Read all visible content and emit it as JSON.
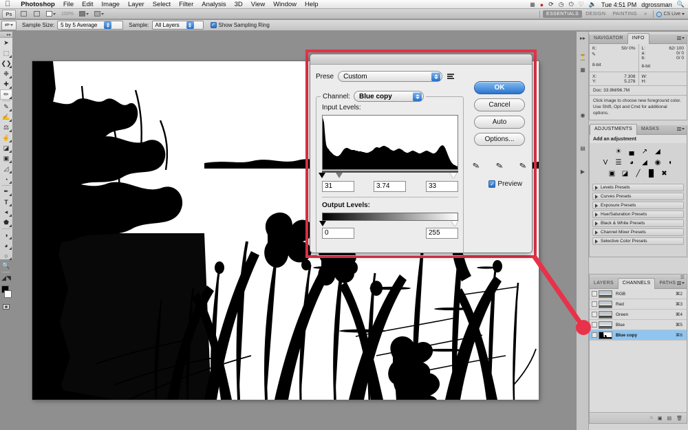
{
  "menubar": {
    "apple": "",
    "app_name": "Photoshop",
    "items": [
      "File",
      "Edit",
      "Image",
      "Layer",
      "Select",
      "Filter",
      "Analysis",
      "3D",
      "View",
      "Window",
      "Help"
    ],
    "status_icons": [
      "display-icon",
      "dropbox-icon",
      "sync-icon",
      "timemachine-icon",
      "bluetooth-icon",
      "wifi-icon",
      "volume-icon"
    ],
    "time": "Tue 4:51 PM",
    "user": "dgrossman",
    "spotlight": "search-icon"
  },
  "appbar": {
    "logo": "Ps",
    "zoom_value": "100%",
    "buttons": [
      "bridge-icon",
      "mini-bridge-icon",
      "view-extras-icon",
      "arrange-documents-icon",
      "screen-mode-icon"
    ],
    "workspaces": [
      "ESSENTIALS",
      "DESIGN",
      "PAINTING"
    ],
    "workspace_active": "ESSENTIALS",
    "overflow": "»",
    "cs_live": "CS Live"
  },
  "options_bar": {
    "tool_icon": "eyedropper-icon",
    "sample_size_label": "Sample Size:",
    "sample_size_value": "5 by 5 Average",
    "sample_label": "Sample:",
    "sample_value": "All Layers",
    "show_sampling_ring": "Show Sampling Ring",
    "show_sampling_ring_checked": true
  },
  "tools": [
    {
      "name": "move-tool",
      "glyph": "➤"
    },
    {
      "name": "marquee-tool",
      "glyph": "⬚"
    },
    {
      "name": "lasso-tool",
      "glyph": "❦"
    },
    {
      "name": "quick-selection-tool",
      "glyph": "❁"
    },
    {
      "name": "crop-tool",
      "glyph": "✙"
    },
    {
      "name": "eyedropper-tool",
      "glyph": "✒",
      "selected": true
    },
    {
      "name": "spot-healing-tool",
      "glyph": "✐"
    },
    {
      "name": "brush-tool",
      "glyph": "✎"
    },
    {
      "name": "clone-stamp-tool",
      "glyph": "⚓"
    },
    {
      "name": "history-brush-tool",
      "glyph": "✐"
    },
    {
      "name": "eraser-tool",
      "glyph": "◰"
    },
    {
      "name": "gradient-tool",
      "glyph": "▣"
    },
    {
      "name": "blur-tool",
      "glyph": "◍"
    },
    {
      "name": "dodge-tool",
      "glyph": "◔"
    },
    {
      "name": "pen-tool",
      "glyph": "✒"
    },
    {
      "name": "type-tool",
      "glyph": "T"
    },
    {
      "name": "path-selection-tool",
      "glyph": "➤"
    },
    {
      "name": "shape-tool",
      "glyph": "⬟"
    },
    {
      "name": "3d-rotate-tool",
      "glyph": "◑"
    },
    {
      "name": "3d-camera-tool",
      "glyph": "◕"
    },
    {
      "name": "hand-tool",
      "glyph": "✋"
    },
    {
      "name": "zoom-tool",
      "glyph": "⚲"
    }
  ],
  "levels_dialog": {
    "preset_label": "Prese",
    "preset_value": "Custom",
    "preset_menu_icon": "preset-options-icon",
    "channel_label": "Channel:",
    "channel_value": "Blue copy",
    "input_levels_label": "Input Levels:",
    "input_shadow": "31",
    "input_midtone": "3.74",
    "input_highlight": "33",
    "output_levels_label": "Output Levels:",
    "output_black": "0",
    "output_white": "255",
    "buttons": {
      "ok": "OK",
      "cancel": "Cancel",
      "auto": "Auto",
      "options": "Options..."
    },
    "eyedroppers": [
      "set-black-point-icon",
      "set-gray-point-icon",
      "set-white-point-icon"
    ],
    "preview_label": "Preview",
    "preview_checked": true,
    "histogram": {
      "note": "Input Levels histogram for the Blue copy channel",
      "values": [
        96,
        62,
        40,
        34,
        32,
        30,
        29,
        27,
        24,
        22,
        21,
        24,
        28,
        33,
        36,
        34,
        31,
        30,
        30,
        29,
        30,
        31,
        30,
        29,
        28,
        27,
        26,
        26,
        27,
        26,
        25,
        26,
        28,
        33,
        37,
        36,
        34,
        33,
        35,
        38,
        36,
        33,
        31,
        29,
        27,
        26,
        28,
        33,
        40,
        44,
        41,
        36,
        30,
        24,
        18,
        12,
        8,
        6,
        5,
        4
      ]
    }
  },
  "annotation": {
    "highlight_color": "#e8324a",
    "callout_from": "levels-dialog",
    "callout_to": "channel-blue-copy"
  },
  "info_panel": {
    "tabs": [
      "NAVIGATOR",
      "INFO"
    ],
    "active_tab": "INFO",
    "left": {
      "k_label": "K:",
      "k_value": "50/   0%",
      "bit_depth": "8-bit"
    },
    "right": {
      "rows": [
        {
          "k": "L:",
          "v": "62/  100"
        },
        {
          "k": "a:",
          "v": "0/    0"
        },
        {
          "k": "b:",
          "v": "0/    0"
        }
      ],
      "bit_depth": "8-bit"
    },
    "coords": {
      "x_label": "X:",
      "x_value": "7.308",
      "y_label": "Y:",
      "y_value": "5.278"
    },
    "dimensions": {
      "w_label": "W:",
      "w_value": "",
      "h_label": "H:",
      "h_value": ""
    },
    "doc_line": "Doc: 33.9M/96.7M",
    "hint": "Click image to choose new foreground color.  Use Shift, Opt and Cmd for additional options."
  },
  "adjustments_panel": {
    "tabs": [
      "ADJUSTMENTS",
      "MASKS"
    ],
    "active_tab": "ADJUSTMENTS",
    "subtitle": "Add an adjustment",
    "icon_rows": [
      [
        "brightness-contrast-icon",
        "levels-icon",
        "curves-icon",
        "exposure-icon"
      ],
      [
        "vibrance-icon",
        "hue-saturation-icon",
        "color-balance-icon",
        "black-white-icon",
        "photo-filter-icon",
        "channel-mixer-icon"
      ],
      [
        "invert-icon",
        "posterize-icon",
        "threshold-icon",
        "gradient-map-icon",
        "selective-color-icon"
      ]
    ],
    "presets": [
      "Levels Presets",
      "Curves Presets",
      "Exposure Presets",
      "Hue/Saturation Presets",
      "Black & White Presets",
      "Channel Mixer Presets",
      "Selective Color Presets"
    ]
  },
  "channels_panel": {
    "tabs": [
      "LAYERS",
      "CHANNELS",
      "PATHS"
    ],
    "active_tab": "CHANNELS",
    "rows": [
      {
        "name": "RGB",
        "shortcut": "⌘2",
        "visible": false,
        "selected": false
      },
      {
        "name": "Red",
        "shortcut": "⌘3",
        "visible": false,
        "selected": false
      },
      {
        "name": "Green",
        "shortcut": "⌘4",
        "visible": false,
        "selected": false
      },
      {
        "name": "Blue",
        "shortcut": "⌘5",
        "visible": false,
        "selected": false
      },
      {
        "name": "Blue copy",
        "shortcut": "⌘6",
        "visible": false,
        "selected": true
      }
    ],
    "footer_icons": [
      "load-channel-as-selection-icon",
      "save-selection-as-channel-icon",
      "create-new-channel-icon",
      "delete-channel-icon"
    ]
  }
}
